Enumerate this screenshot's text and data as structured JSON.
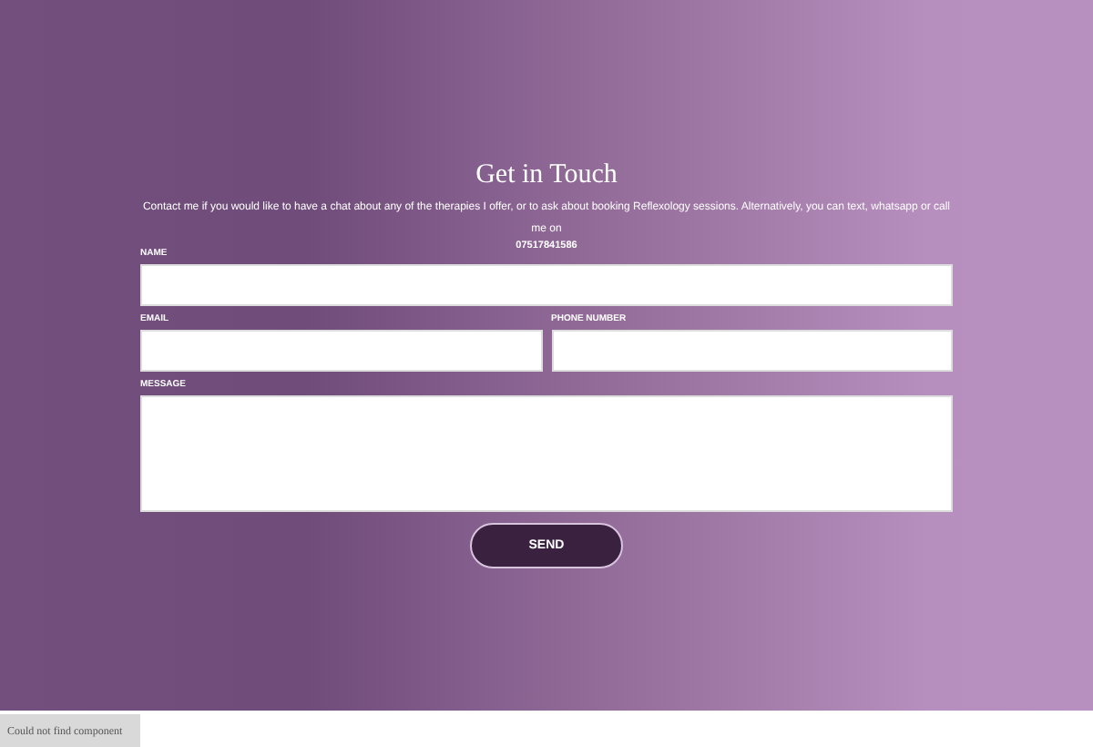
{
  "title": "Get in Touch",
  "description": "Contact me if you would like to have a chat about any of the therapies I offer, or to ask about booking Reflexology sessions. Alternatively, you can text, whatsapp or call me on",
  "phone": "07517841586",
  "rows": [
    [
      {
        "label": "NAME",
        "kind": "text"
      }
    ],
    [
      {
        "label": "EMAIL",
        "kind": "text"
      },
      {
        "label": "PHONE NUMBER",
        "kind": "text"
      }
    ],
    [
      {
        "label": "MESSAGE",
        "kind": "textarea"
      }
    ]
  ],
  "submit": "SEND",
  "notice": "Could not find component"
}
